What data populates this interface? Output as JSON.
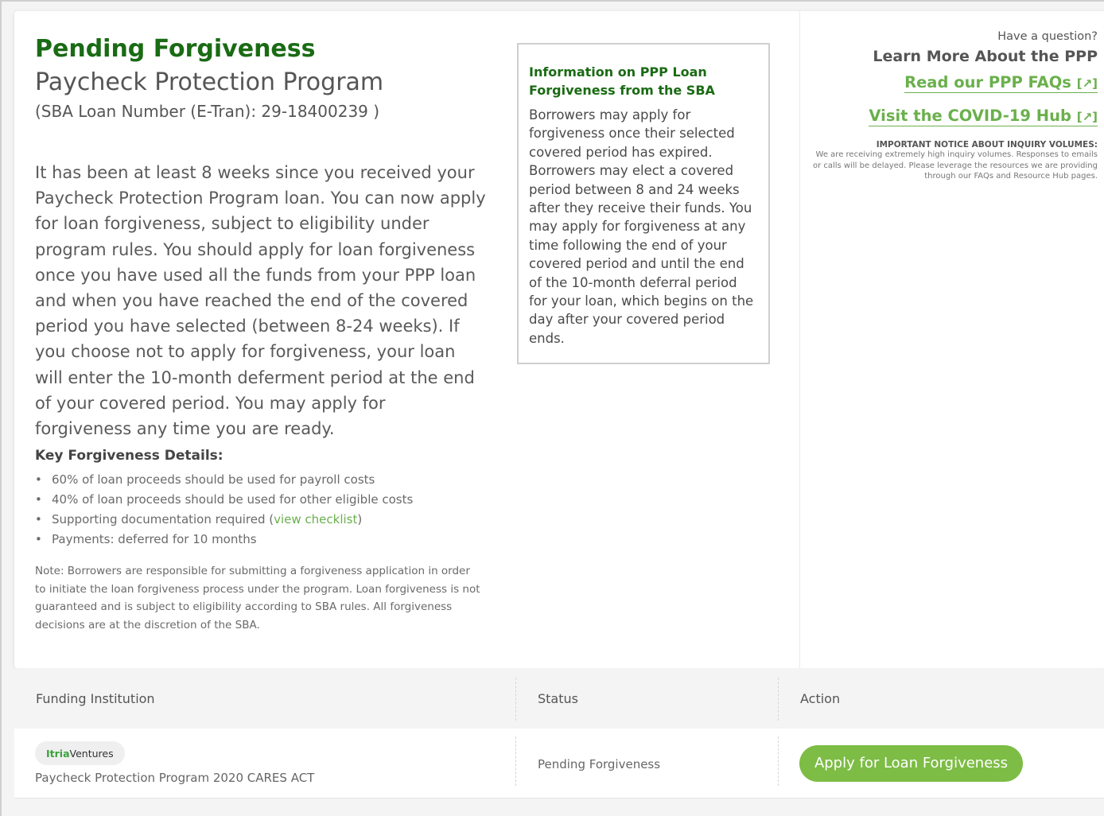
{
  "header": {
    "status_title": "Pending Forgiveness",
    "program_title": "Paycheck Protection Program",
    "loan_number_label": "(SBA Loan Number (E-Tran): 29-18400239 )"
  },
  "intro_text": "It has been at least 8 weeks since you received your Paycheck Protection Program loan. You can now apply for loan forgiveness, subject to eligibility under program rules. You should apply for loan forgiveness once you have used all the funds from your PPP loan and when you have reached the end of the covered period you have selected (between 8-24 weeks). If you choose not to apply for forgiveness, your loan will enter the 10-month deferment period at the end of your covered period. You may apply for forgiveness any time you are ready.",
  "key_details": {
    "heading": "Key Forgiveness Details:",
    "items": [
      "60% of loan proceeds should be used for payroll costs",
      "40% of loan proceeds should be used for other eligible costs",
      "Payments: deferred for 10 months"
    ],
    "doc_item_prefix": "Supporting documentation required (",
    "doc_item_link": "view checklist",
    "doc_item_suffix": ")"
  },
  "note": "Note: Borrowers are responsible for submitting a forgiveness application in order to initiate the loan forgiveness process under the program. Loan forgiveness is not guaranteed and is subject to eligibility according to SBA rules. All forgiveness decisions are at the discretion of the SBA.",
  "infobox": {
    "title": "Information on PPP Loan Forgiveness from the SBA",
    "body": "Borrowers may apply for forgiveness once their selected covered period has expired. Borrowers may elect a covered period between 8 and 24 weeks after they receive their funds. You may apply for forgiveness at any time following the end of your covered period and until the end of the 10-month deferral period for your loan, which begins on the day after your covered period ends."
  },
  "sidebar": {
    "question": "Have a question?",
    "learn_more": "Learn More About the PPP",
    "faq_link": "Read our PPP FAQs",
    "hub_link": "Visit the COVID-19 Hub",
    "external_marker": "[↗]",
    "notice_heading": "IMPORTANT NOTICE ABOUT INQUIRY VOLUMES:",
    "notice_body": "We are receiving extremely high inquiry volumes. Responses to emails or calls will be delayed. Please leverage the resources we are providing through our FAQs and Resource Hub pages."
  },
  "table": {
    "headers": [
      "Funding Institution",
      "Status",
      "Action"
    ],
    "row": {
      "logo_part1": "Itria",
      "logo_part2": "Ventures",
      "program": "Paycheck Protection Program 2020 CARES ACT",
      "status": "Pending Forgiveness",
      "action_label": "Apply for Loan Forgiveness"
    }
  },
  "colors": {
    "title_green": "#1a6b14",
    "link_green": "#6ab04c",
    "button_green": "#7dbc45"
  }
}
